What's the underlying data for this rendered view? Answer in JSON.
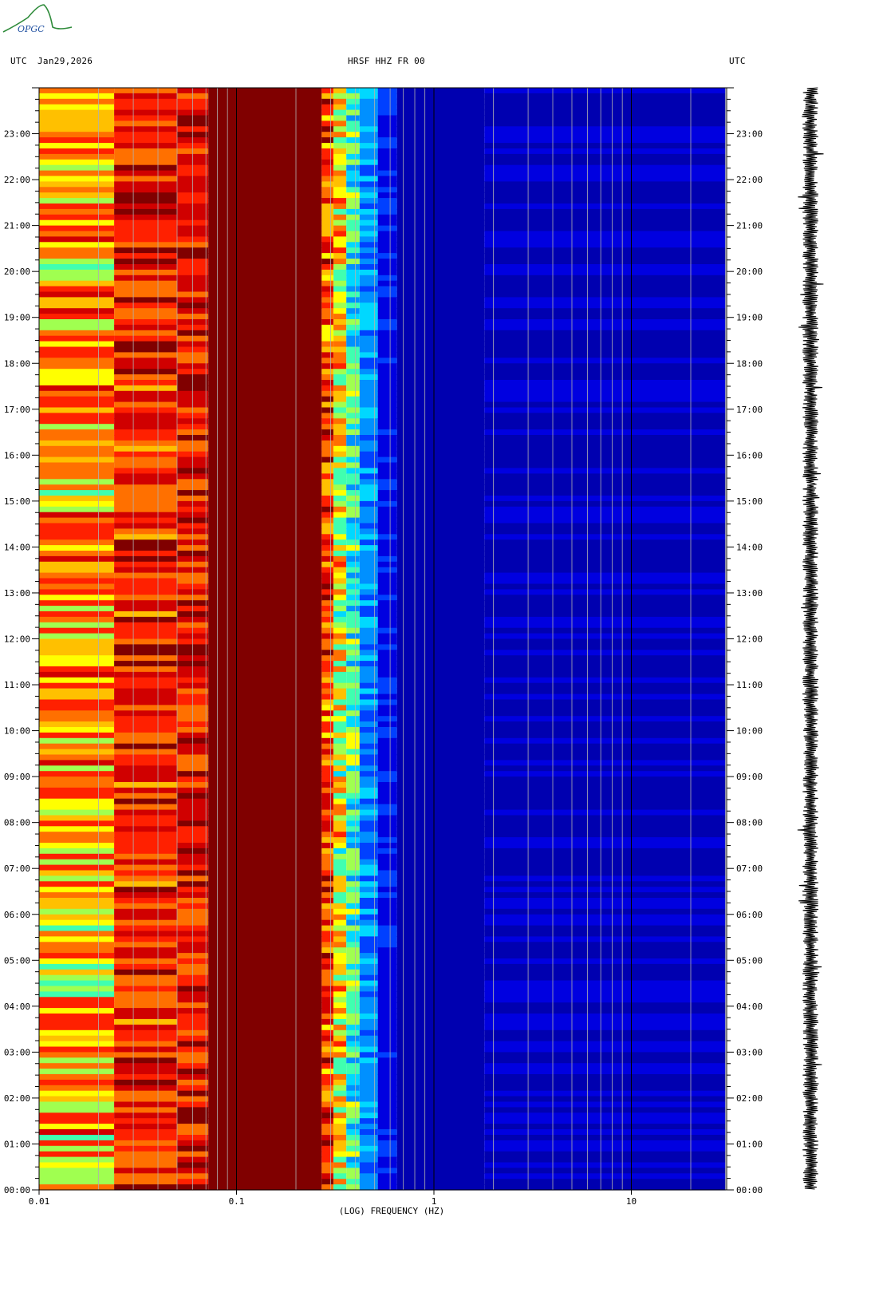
{
  "header": {
    "logo_text": "OPGC",
    "left_utc": "UTC",
    "date": "Jan29,2026",
    "station": "HRSF HHZ FR 00",
    "right_utc": "UTC"
  },
  "chart_data": {
    "type": "heatmap",
    "title": "HRSF HHZ FR 00",
    "xlabel": "(LOG) FREQUENCY (HZ)",
    "ylabel": "UTC",
    "x_scale": "log",
    "xlim": [
      0.01,
      30
    ],
    "x_ticks": [
      0.01,
      0.1,
      1,
      10
    ],
    "x_tick_labels": [
      "0.01",
      "0.1",
      "1",
      "10"
    ],
    "ylim_hours": [
      0,
      24
    ],
    "y_tick_labels": [
      "00:00",
      "01:00",
      "02:00",
      "03:00",
      "04:00",
      "05:00",
      "06:00",
      "07:00",
      "08:00",
      "09:00",
      "10:00",
      "11:00",
      "12:00",
      "13:00",
      "14:00",
      "15:00",
      "16:00",
      "17:00",
      "18:00",
      "19:00",
      "20:00",
      "21:00",
      "22:00",
      "23:00"
    ],
    "grid": true,
    "colors": {
      "very_high": "#800000",
      "high": "#cc0000",
      "medium_high": "#ff8000",
      "medium": "#ffff00",
      "medium_low": "#80ff80",
      "low": "#00c0ff",
      "very_low": "#0000cc",
      "lowest": "#000080"
    }
  }
}
